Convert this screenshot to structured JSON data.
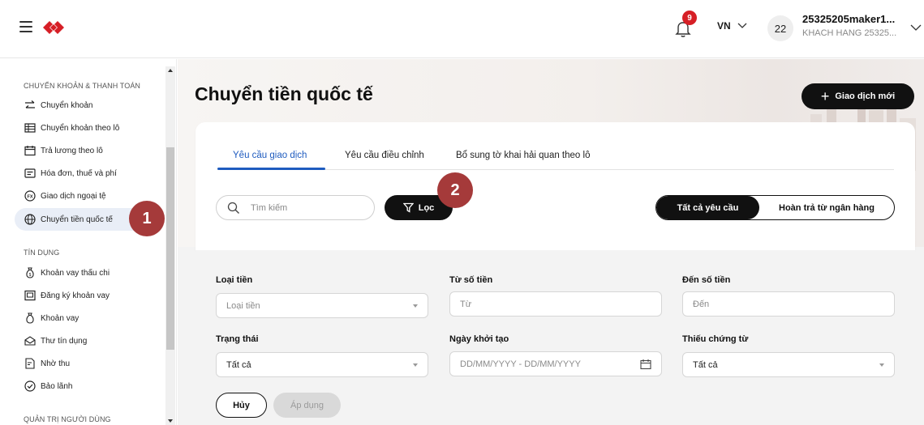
{
  "header": {
    "notification_count": "9",
    "language": "VN",
    "avatar_initials": "22",
    "user_name": "25325205maker1...",
    "user_company": "KHACH HANG 25325..."
  },
  "sidebar": {
    "sections": [
      {
        "label": "CHUYỂN KHOẢN & THANH TOÁN"
      },
      {
        "label": "TÍN DỤNG"
      },
      {
        "label": "QUẢN TRỊ NGƯỜI DÙNG"
      }
    ],
    "items": [
      {
        "label": "Chuyển khoản",
        "icon": "transfer-icon"
      },
      {
        "label": "Chuyển khoản theo lô",
        "icon": "table-icon"
      },
      {
        "label": "Trả lương theo lô",
        "icon": "calendar-icon"
      },
      {
        "label": "Hóa đơn, thuế và phí",
        "icon": "bill-icon"
      },
      {
        "label": "Giao dịch ngoại tệ",
        "icon": "fx-icon"
      },
      {
        "label": "Chuyển tiền quốc tế",
        "icon": "globe-icon",
        "active": true
      },
      {
        "label": "Khoản vay thấu chi",
        "icon": "money-bag-icon"
      },
      {
        "label": "Đăng ký khoản vay",
        "icon": "register-icon"
      },
      {
        "label": "Khoản vay",
        "icon": "loan-icon"
      },
      {
        "label": "Thư tín dụng",
        "icon": "envelope-icon"
      },
      {
        "label": "Nhờ thu",
        "icon": "document-icon"
      },
      {
        "label": "Bảo lãnh",
        "icon": "check-circle-icon"
      }
    ]
  },
  "main": {
    "title": "Chuyển tiền quốc tế",
    "new_transaction": "Giao dịch mới",
    "tabs": [
      {
        "label": "Yêu cầu giao dịch",
        "active": true
      },
      {
        "label": "Yêu cầu điều chỉnh"
      },
      {
        "label": "Bổ sung tờ khai hải quan theo lô"
      }
    ],
    "search_placeholder": "Tìm kiếm",
    "filter_button": "Lọc",
    "segment": {
      "all": "Tất cả yêu cầu",
      "refund": "Hoàn trả từ ngân hàng"
    }
  },
  "filters": {
    "currency": {
      "label": "Loại tiền",
      "placeholder": "Loại tiền"
    },
    "from_amount": {
      "label": "Từ số tiền",
      "placeholder": "Từ"
    },
    "to_amount": {
      "label": "Đến số tiền",
      "placeholder": "Đến"
    },
    "status": {
      "label": "Trạng thái",
      "value": "Tất cả"
    },
    "created_date": {
      "label": "Ngày khởi tạo",
      "placeholder": "DD/MM/YYYY - DD/MM/YYYY"
    },
    "missing_docs": {
      "label": "Thiếu chứng từ",
      "value": "Tất cả"
    },
    "cancel": "Hủy",
    "apply": "Áp dụng"
  },
  "callouts": {
    "one": "1",
    "two": "2"
  },
  "colors": {
    "brand_red": "#d61f26",
    "accent_blue": "#1e5bbf",
    "callout": "#a53a3a",
    "dark": "#111111"
  }
}
